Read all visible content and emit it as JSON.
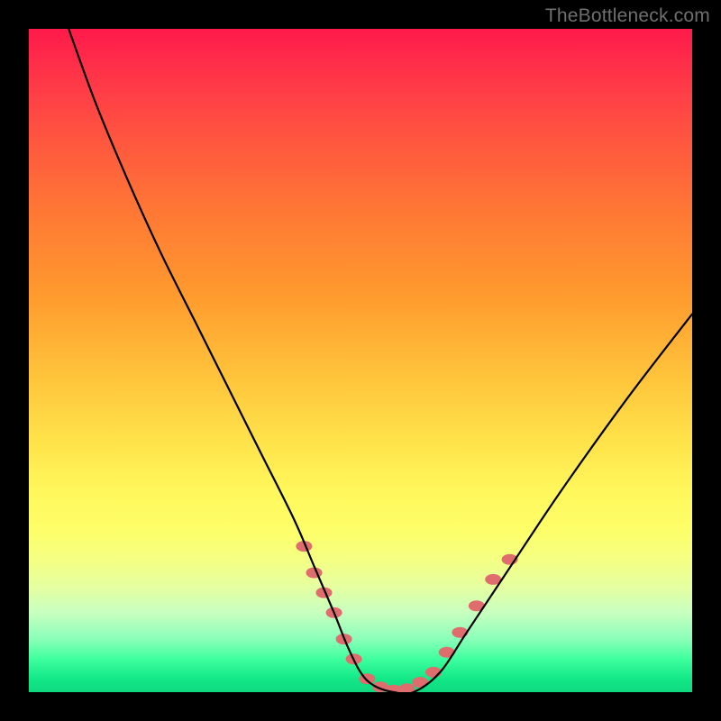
{
  "attribution": "TheBottleneck.com",
  "chart_data": {
    "type": "line",
    "title": "",
    "xlabel": "",
    "ylabel": "",
    "xlim": [
      0,
      100
    ],
    "ylim": [
      0,
      100
    ],
    "grid": false,
    "legend": false,
    "background_gradient": {
      "orientation": "vertical",
      "stops": [
        {
          "pos": 0.0,
          "color": "#ff1a4b"
        },
        {
          "pos": 0.3,
          "color": "#ff7a34"
        },
        {
          "pos": 0.62,
          "color": "#ffe24a"
        },
        {
          "pos": 0.8,
          "color": "#f4ff82"
        },
        {
          "pos": 0.92,
          "color": "#8affb9"
        },
        {
          "pos": 1.0,
          "color": "#0fd87f"
        }
      ]
    },
    "series": [
      {
        "name": "bottleneck-curve",
        "color": "#000000",
        "x": [
          6,
          10,
          15,
          20,
          25,
          30,
          35,
          40,
          43,
          46,
          48,
          50,
          52,
          55,
          58,
          62,
          66,
          72,
          80,
          90,
          100
        ],
        "y": [
          100,
          89,
          77,
          66,
          56,
          46,
          36,
          26,
          19,
          12,
          7,
          3,
          1,
          0,
          0,
          3,
          9,
          18,
          30,
          44,
          57
        ]
      }
    ],
    "markers": [
      {
        "name": "left-cluster",
        "color": "#e06d6d",
        "shape": "rounded-pill",
        "points": [
          {
            "x": 41.5,
            "y": 22
          },
          {
            "x": 43.0,
            "y": 18
          },
          {
            "x": 44.5,
            "y": 15
          },
          {
            "x": 46.0,
            "y": 12
          },
          {
            "x": 47.5,
            "y": 8
          },
          {
            "x": 49.0,
            "y": 5
          },
          {
            "x": 51.0,
            "y": 2
          },
          {
            "x": 53.0,
            "y": 0.8
          },
          {
            "x": 55.0,
            "y": 0.3
          },
          {
            "x": 57.0,
            "y": 0.5
          }
        ]
      },
      {
        "name": "right-cluster",
        "color": "#e06d6d",
        "shape": "rounded-pill",
        "points": [
          {
            "x": 59.0,
            "y": 1.5
          },
          {
            "x": 61.0,
            "y": 3
          },
          {
            "x": 63.0,
            "y": 6
          },
          {
            "x": 65.0,
            "y": 9
          },
          {
            "x": 67.5,
            "y": 13
          },
          {
            "x": 70.0,
            "y": 17
          },
          {
            "x": 72.5,
            "y": 20
          }
        ]
      }
    ]
  }
}
